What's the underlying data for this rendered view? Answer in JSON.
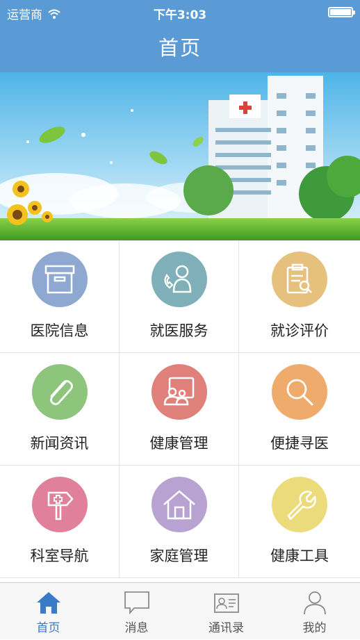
{
  "status_bar": {
    "carrier": "运营商",
    "time": "下午3:03"
  },
  "nav": {
    "title": "首页"
  },
  "grid": [
    {
      "label": "医院信息",
      "icon": "archive-box-icon",
      "color": "#8fa8d2"
    },
    {
      "label": "就医服务",
      "icon": "phone-person-icon",
      "color": "#7fb0b9"
    },
    {
      "label": "就诊评价",
      "icon": "clipboard-search-icon",
      "color": "#e6c07d"
    },
    {
      "label": "新闻资讯",
      "icon": "paperclip-icon",
      "color": "#8dc57c"
    },
    {
      "label": "健康管理",
      "icon": "people-board-icon",
      "color": "#e0807a"
    },
    {
      "label": "便捷寻医",
      "icon": "magnifier-icon",
      "color": "#eeab6b"
    },
    {
      "label": "科室导航",
      "icon": "signpost-cross-icon",
      "color": "#e0809a"
    },
    {
      "label": "家庭管理",
      "icon": "house-icon",
      "color": "#b7a2d1"
    },
    {
      "label": "健康工具",
      "icon": "wrench-icon",
      "color": "#ecdb7b"
    }
  ],
  "tabs": [
    {
      "label": "首页",
      "icon": "home-icon",
      "active": true
    },
    {
      "label": "消息",
      "icon": "message-icon",
      "active": false
    },
    {
      "label": "通讯录",
      "icon": "contacts-card-icon",
      "active": false
    },
    {
      "label": "我的",
      "icon": "user-icon",
      "active": false
    }
  ],
  "colors": {
    "nav_bg": "#5b9bd5",
    "active_tab": "#3a7bc8",
    "inactive_tab": "#8a8a8a"
  }
}
